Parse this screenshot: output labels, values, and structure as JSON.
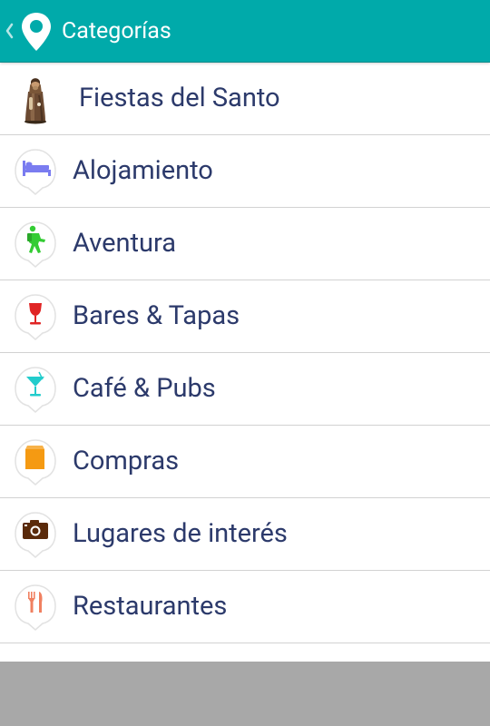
{
  "header": {
    "title": "Categorías",
    "back_icon": "chevron-left-icon",
    "app_icon": "map-pin-icon",
    "bar_color": "#00aaaa"
  },
  "categories": [
    {
      "label": "Fiestas del Santo",
      "icon": "saint-figure-icon"
    },
    {
      "label": "Alojamiento",
      "icon": "bed-icon",
      "color": "#7a7cf0"
    },
    {
      "label": "Aventura",
      "icon": "hiker-icon",
      "color": "#33cc33"
    },
    {
      "label": "Bares & Tapas",
      "icon": "wine-glass-icon",
      "color": "#e02424"
    },
    {
      "label": "Café & Pubs",
      "icon": "cocktail-glass-icon",
      "color": "#22cccc"
    },
    {
      "label": "Compras",
      "icon": "shopping-bag-icon",
      "color": "#f59a12"
    },
    {
      "label": "Lugares de interés",
      "icon": "camera-icon",
      "color": "#5a2a0a"
    },
    {
      "label": "Restaurantes",
      "icon": "fork-knife-icon",
      "color": "#f08060"
    }
  ]
}
